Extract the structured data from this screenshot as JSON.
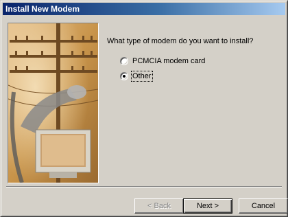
{
  "window": {
    "title": "Install New Modem"
  },
  "wizard": {
    "question": "What type of modem do you want to install?",
    "options": [
      {
        "label": "PCMCIA modem card",
        "selected": false
      },
      {
        "label": "Other",
        "selected": true
      }
    ]
  },
  "buttons": {
    "back": "< Back",
    "next": "Next >",
    "cancel": "Cancel"
  },
  "colors": {
    "title_gradient_start": "#0a246a",
    "title_gradient_end": "#a6caf0",
    "dialog_face": "#d4d0c8",
    "art_tint": "#c8944a"
  },
  "icons": [
    "telephone-pole-illustration",
    "monitor-illustration"
  ]
}
